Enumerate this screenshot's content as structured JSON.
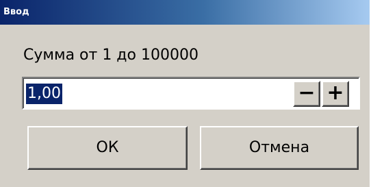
{
  "window": {
    "title": "Ввод"
  },
  "prompt": {
    "text": "Сумма от 1 до 100000"
  },
  "amount_input": {
    "value": "1,00"
  },
  "stepper": {
    "minus_label": "−",
    "plus_label": "+"
  },
  "buttons": {
    "ok_label": "ОК",
    "cancel_label": "Отмена"
  },
  "colors": {
    "titlebar_start": "#0a246a",
    "titlebar_end": "#a6caf0",
    "dialog_background": "#d4d0c8",
    "selection_background": "#0a246a",
    "selection_text": "#ffffff"
  }
}
